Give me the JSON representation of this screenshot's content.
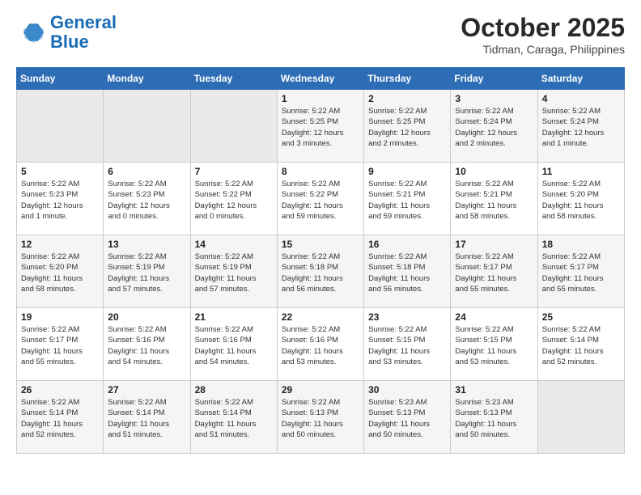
{
  "logo": {
    "line1": "General",
    "line2": "Blue"
  },
  "header": {
    "month": "October 2025",
    "location": "Tidman, Caraga, Philippines"
  },
  "weekdays": [
    "Sunday",
    "Monday",
    "Tuesday",
    "Wednesday",
    "Thursday",
    "Friday",
    "Saturday"
  ],
  "weeks": [
    [
      {
        "day": "",
        "detail": ""
      },
      {
        "day": "",
        "detail": ""
      },
      {
        "day": "",
        "detail": ""
      },
      {
        "day": "1",
        "detail": "Sunrise: 5:22 AM\nSunset: 5:25 PM\nDaylight: 12 hours\nand 3 minutes."
      },
      {
        "day": "2",
        "detail": "Sunrise: 5:22 AM\nSunset: 5:25 PM\nDaylight: 12 hours\nand 2 minutes."
      },
      {
        "day": "3",
        "detail": "Sunrise: 5:22 AM\nSunset: 5:24 PM\nDaylight: 12 hours\nand 2 minutes."
      },
      {
        "day": "4",
        "detail": "Sunrise: 5:22 AM\nSunset: 5:24 PM\nDaylight: 12 hours\nand 1 minute."
      }
    ],
    [
      {
        "day": "5",
        "detail": "Sunrise: 5:22 AM\nSunset: 5:23 PM\nDaylight: 12 hours\nand 1 minute."
      },
      {
        "day": "6",
        "detail": "Sunrise: 5:22 AM\nSunset: 5:23 PM\nDaylight: 12 hours\nand 0 minutes."
      },
      {
        "day": "7",
        "detail": "Sunrise: 5:22 AM\nSunset: 5:22 PM\nDaylight: 12 hours\nand 0 minutes."
      },
      {
        "day": "8",
        "detail": "Sunrise: 5:22 AM\nSunset: 5:22 PM\nDaylight: 11 hours\nand 59 minutes."
      },
      {
        "day": "9",
        "detail": "Sunrise: 5:22 AM\nSunset: 5:21 PM\nDaylight: 11 hours\nand 59 minutes."
      },
      {
        "day": "10",
        "detail": "Sunrise: 5:22 AM\nSunset: 5:21 PM\nDaylight: 11 hours\nand 58 minutes."
      },
      {
        "day": "11",
        "detail": "Sunrise: 5:22 AM\nSunset: 5:20 PM\nDaylight: 11 hours\nand 58 minutes."
      }
    ],
    [
      {
        "day": "12",
        "detail": "Sunrise: 5:22 AM\nSunset: 5:20 PM\nDaylight: 11 hours\nand 58 minutes."
      },
      {
        "day": "13",
        "detail": "Sunrise: 5:22 AM\nSunset: 5:19 PM\nDaylight: 11 hours\nand 57 minutes."
      },
      {
        "day": "14",
        "detail": "Sunrise: 5:22 AM\nSunset: 5:19 PM\nDaylight: 11 hours\nand 57 minutes."
      },
      {
        "day": "15",
        "detail": "Sunrise: 5:22 AM\nSunset: 5:18 PM\nDaylight: 11 hours\nand 56 minutes."
      },
      {
        "day": "16",
        "detail": "Sunrise: 5:22 AM\nSunset: 5:18 PM\nDaylight: 11 hours\nand 56 minutes."
      },
      {
        "day": "17",
        "detail": "Sunrise: 5:22 AM\nSunset: 5:17 PM\nDaylight: 11 hours\nand 55 minutes."
      },
      {
        "day": "18",
        "detail": "Sunrise: 5:22 AM\nSunset: 5:17 PM\nDaylight: 11 hours\nand 55 minutes."
      }
    ],
    [
      {
        "day": "19",
        "detail": "Sunrise: 5:22 AM\nSunset: 5:17 PM\nDaylight: 11 hours\nand 55 minutes."
      },
      {
        "day": "20",
        "detail": "Sunrise: 5:22 AM\nSunset: 5:16 PM\nDaylight: 11 hours\nand 54 minutes."
      },
      {
        "day": "21",
        "detail": "Sunrise: 5:22 AM\nSunset: 5:16 PM\nDaylight: 11 hours\nand 54 minutes."
      },
      {
        "day": "22",
        "detail": "Sunrise: 5:22 AM\nSunset: 5:16 PM\nDaylight: 11 hours\nand 53 minutes."
      },
      {
        "day": "23",
        "detail": "Sunrise: 5:22 AM\nSunset: 5:15 PM\nDaylight: 11 hours\nand 53 minutes."
      },
      {
        "day": "24",
        "detail": "Sunrise: 5:22 AM\nSunset: 5:15 PM\nDaylight: 11 hours\nand 53 minutes."
      },
      {
        "day": "25",
        "detail": "Sunrise: 5:22 AM\nSunset: 5:14 PM\nDaylight: 11 hours\nand 52 minutes."
      }
    ],
    [
      {
        "day": "26",
        "detail": "Sunrise: 5:22 AM\nSunset: 5:14 PM\nDaylight: 11 hours\nand 52 minutes."
      },
      {
        "day": "27",
        "detail": "Sunrise: 5:22 AM\nSunset: 5:14 PM\nDaylight: 11 hours\nand 51 minutes."
      },
      {
        "day": "28",
        "detail": "Sunrise: 5:22 AM\nSunset: 5:14 PM\nDaylight: 11 hours\nand 51 minutes."
      },
      {
        "day": "29",
        "detail": "Sunrise: 5:22 AM\nSunset: 5:13 PM\nDaylight: 11 hours\nand 50 minutes."
      },
      {
        "day": "30",
        "detail": "Sunrise: 5:23 AM\nSunset: 5:13 PM\nDaylight: 11 hours\nand 50 minutes."
      },
      {
        "day": "31",
        "detail": "Sunrise: 5:23 AM\nSunset: 5:13 PM\nDaylight: 11 hours\nand 50 minutes."
      },
      {
        "day": "",
        "detail": ""
      }
    ]
  ]
}
